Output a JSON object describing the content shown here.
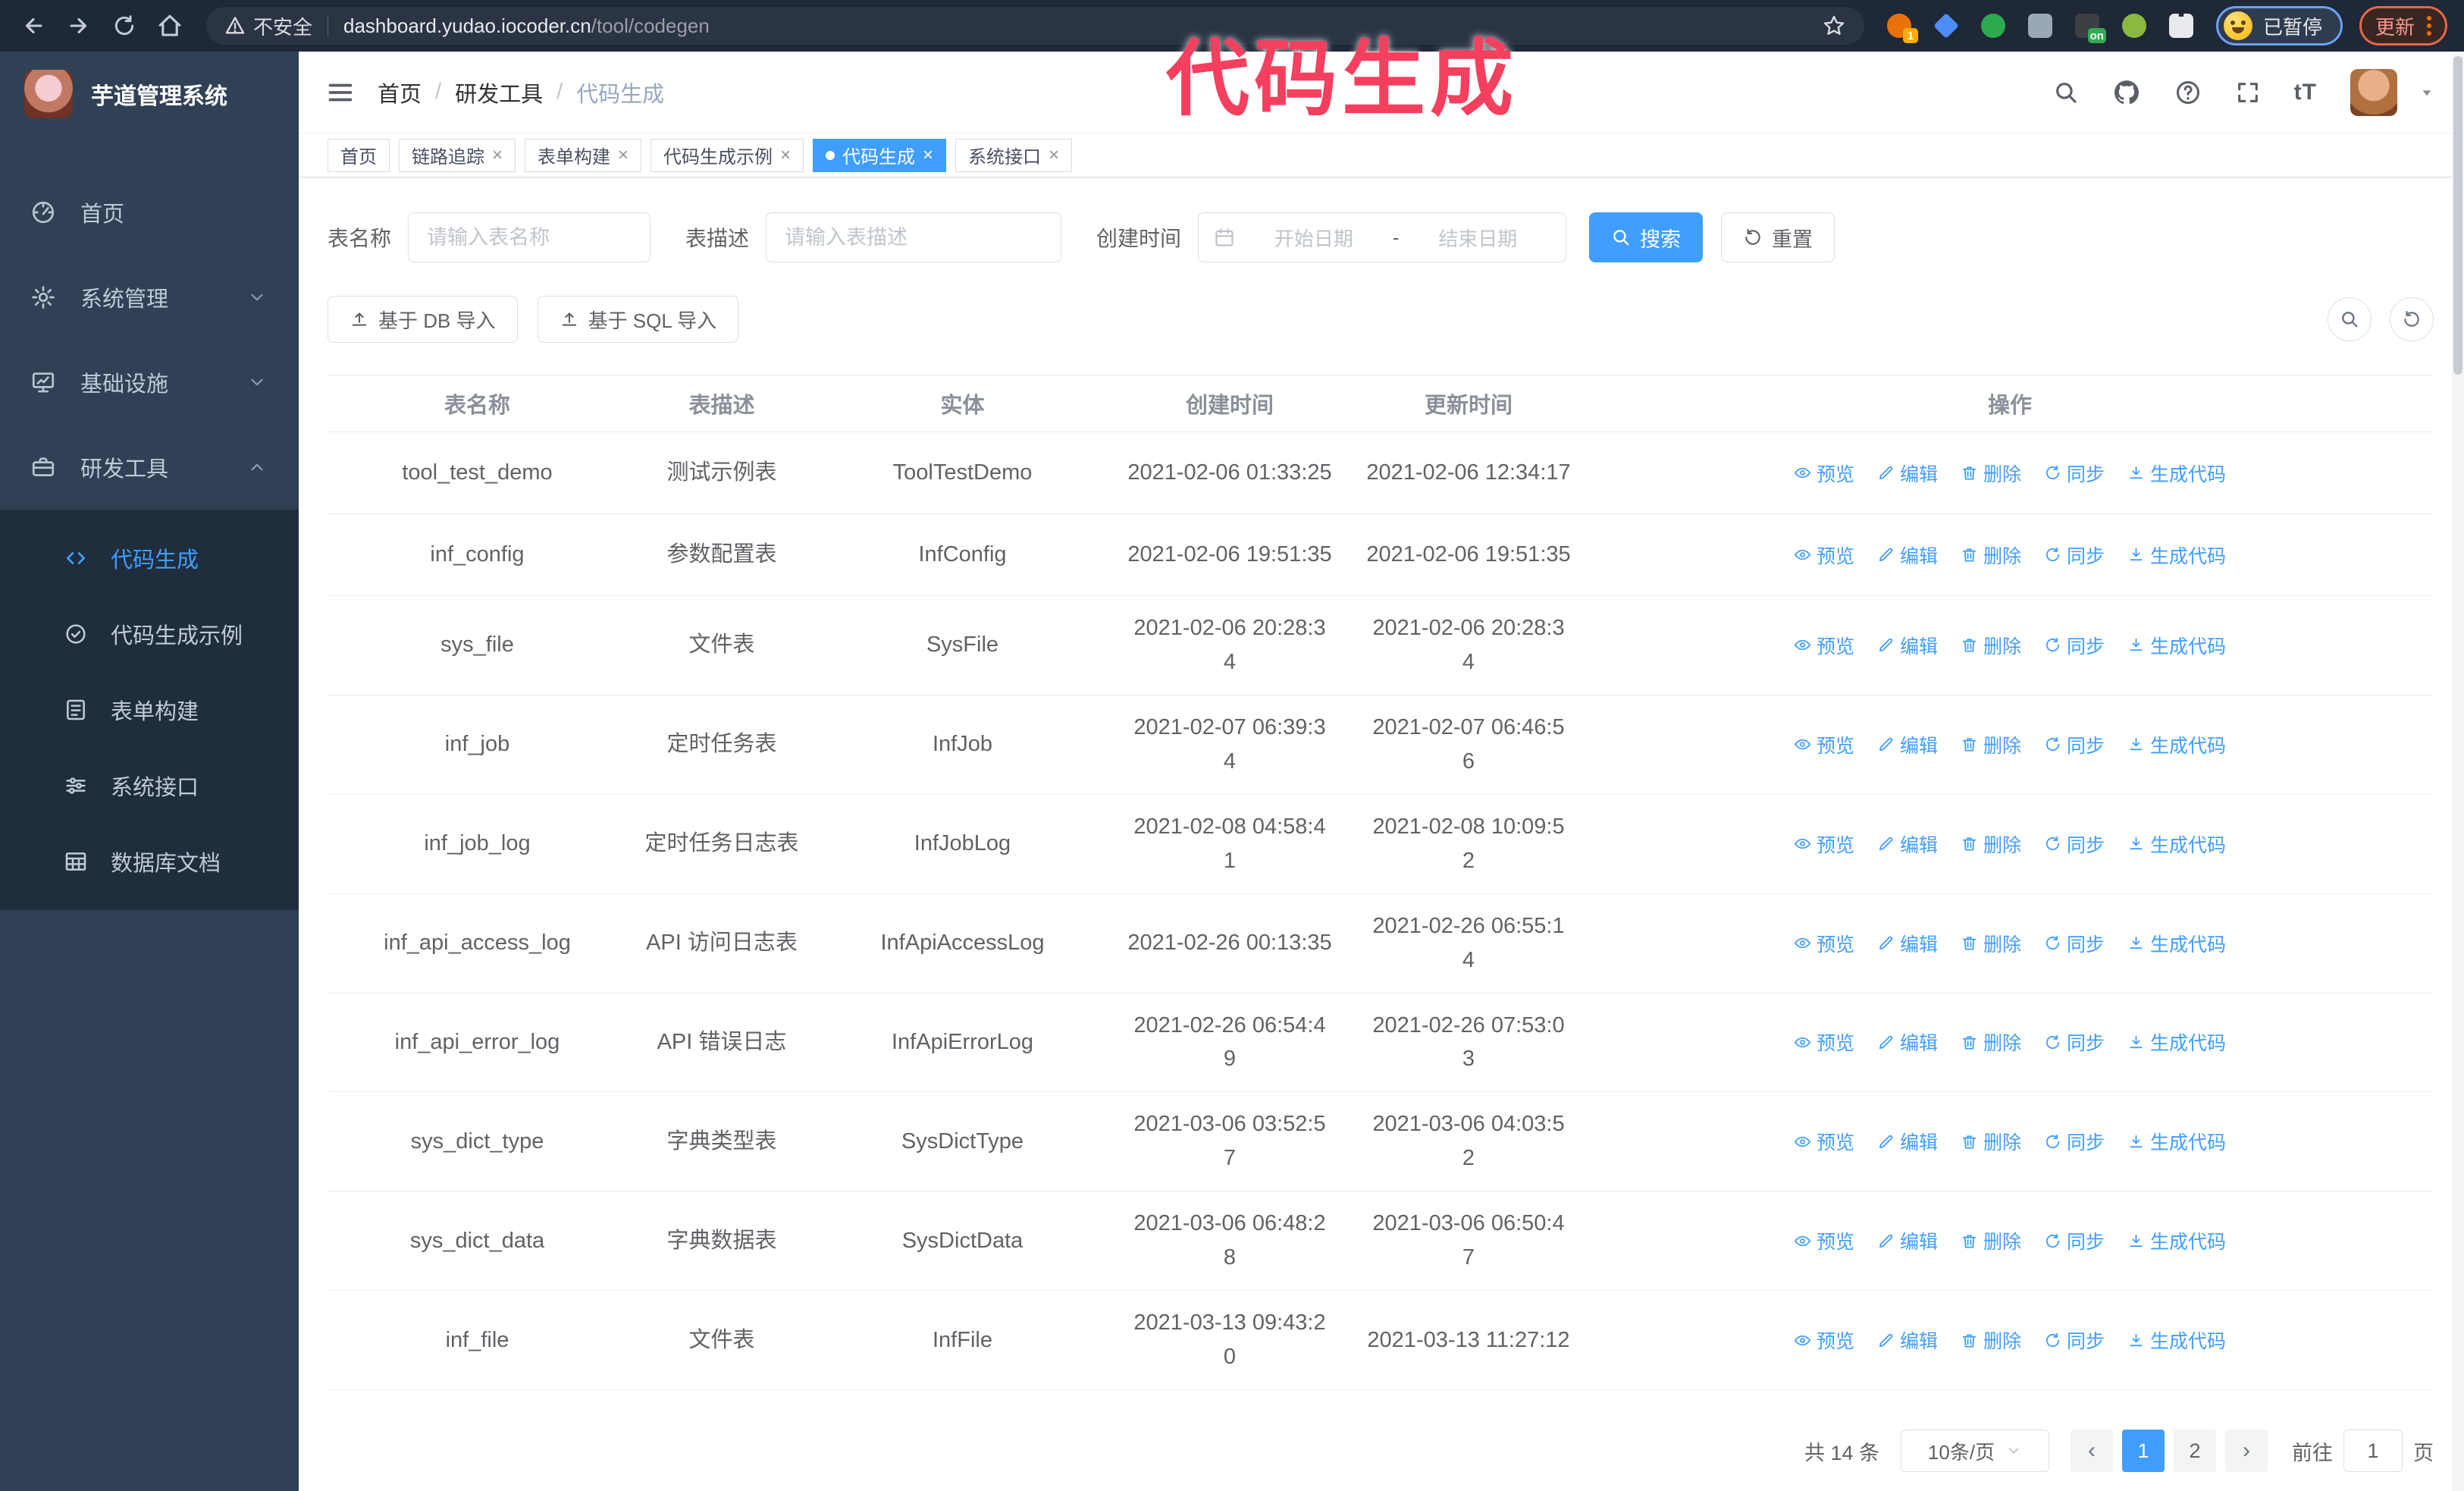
{
  "annotation": {
    "text": "代码生成",
    "color": "#f43f5e"
  },
  "browser": {
    "insecure_label": "不安全",
    "url_domain": "dashboard.yudao.iocoder.cn",
    "url_path": "/tool/codegen",
    "profile_label": "已暂停",
    "update_label": "更新",
    "extensions": [
      {
        "name": "extension-orange",
        "shape": "circle",
        "color": "#e8710a",
        "badge": "1",
        "badge_color": "#f9ab00"
      },
      {
        "name": "extension-blue-gem",
        "shape": "diamond",
        "color": "#4e8cf9"
      },
      {
        "name": "extension-green-check",
        "shape": "circle",
        "color": "#2da94f"
      },
      {
        "name": "extension-grid",
        "shape": "square",
        "color": "#9aa7b5"
      },
      {
        "name": "extension-dark-on",
        "shape": "square",
        "color": "#3c4043",
        "badge": "on",
        "badge_color": "#34a853"
      },
      {
        "name": "extension-green-bot",
        "shape": "circle",
        "color": "#8ab941"
      },
      {
        "name": "extension-puzzle",
        "shape": "puzzle",
        "color": "#e8eaed"
      }
    ]
  },
  "sidebar": {
    "logo_title": "芋道管理系统",
    "items": [
      {
        "id": "home",
        "label": "首页",
        "icon": "i-gauge"
      },
      {
        "id": "system",
        "label": "系统管理",
        "icon": "i-gear",
        "chevron": "down"
      },
      {
        "id": "infra",
        "label": "基础设施",
        "icon": "i-monitor",
        "chevron": "down"
      },
      {
        "id": "devtools",
        "label": "研发工具",
        "icon": "i-toolbox",
        "chevron": "up",
        "active": true
      }
    ],
    "subitems": [
      {
        "id": "codegen",
        "label": "代码生成",
        "icon": "i-code",
        "active": true
      },
      {
        "id": "codegen-demo",
        "label": "代码生成示例",
        "icon": "i-badge"
      },
      {
        "id": "form-builder",
        "label": "表单构建",
        "icon": "i-form"
      },
      {
        "id": "system-api",
        "label": "系统接口",
        "icon": "i-sliders"
      },
      {
        "id": "db-doc",
        "label": "数据库文档",
        "icon": "i-dbgrid"
      }
    ]
  },
  "header": {
    "breadcrumb": [
      "首页",
      "研发工具",
      "代码生成"
    ]
  },
  "tags": [
    {
      "label": "首页",
      "closable": false,
      "active": false
    },
    {
      "label": "链路追踪",
      "closable": true,
      "active": false
    },
    {
      "label": "表单构建",
      "closable": true,
      "active": false
    },
    {
      "label": "代码生成示例",
      "closable": true,
      "active": false
    },
    {
      "label": "代码生成",
      "closable": true,
      "active": true
    },
    {
      "label": "系统接口",
      "closable": true,
      "active": false
    }
  ],
  "filters": {
    "name_label": "表名称",
    "name_placeholder": "请输入表名称",
    "desc_label": "表描述",
    "desc_placeholder": "请输入表描述",
    "time_label": "创建时间",
    "start_placeholder": "开始日期",
    "range_separator": "-",
    "end_placeholder": "结束日期",
    "search_label": "搜索",
    "reset_label": "重置"
  },
  "toolbar": {
    "db_import": "基于 DB 导入",
    "sql_import": "基于 SQL 导入"
  },
  "table": {
    "columns": [
      "表名称",
      "表描述",
      "实体",
      "创建时间",
      "更新时间",
      "操作"
    ],
    "actions": [
      {
        "label": "预览",
        "icon": "eye"
      },
      {
        "label": "编辑",
        "icon": "edit"
      },
      {
        "label": "删除",
        "icon": "trash"
      },
      {
        "label": "同步",
        "icon": "sync"
      },
      {
        "label": "生成代码",
        "icon": "download"
      }
    ],
    "rows": [
      {
        "name": "tool_test_demo",
        "desc": "测试示例表",
        "entity": "ToolTestDemo",
        "created": [
          "2021-02-06 01:33:25"
        ],
        "updated": [
          "2021-02-06 12:34:17"
        ]
      },
      {
        "name": "inf_config",
        "desc": "参数配置表",
        "entity": "InfConfig",
        "created": [
          "2021-02-06 19:51:35"
        ],
        "updated": [
          "2021-02-06 19:51:35"
        ]
      },
      {
        "name": "sys_file",
        "desc": "文件表",
        "entity": "SysFile",
        "created": [
          "2021-02-06 20:28:3",
          "4"
        ],
        "updated": [
          "2021-02-06 20:28:3",
          "4"
        ]
      },
      {
        "name": "inf_job",
        "desc": "定时任务表",
        "entity": "InfJob",
        "created": [
          "2021-02-07 06:39:3",
          "4"
        ],
        "updated": [
          "2021-02-07 06:46:5",
          "6"
        ]
      },
      {
        "name": "inf_job_log",
        "desc": "定时任务日志表",
        "entity": "InfJobLog",
        "created": [
          "2021-02-08 04:58:4",
          "1"
        ],
        "updated": [
          "2021-02-08 10:09:5",
          "2"
        ]
      },
      {
        "name": "inf_api_access_log",
        "desc": "API 访问日志表",
        "entity": "InfApiAccessLog",
        "created": [
          "2021-02-26 00:13:35"
        ],
        "updated": [
          "2021-02-26 06:55:1",
          "4"
        ]
      },
      {
        "name": "inf_api_error_log",
        "desc": "API 错误日志",
        "entity": "InfApiErrorLog",
        "created": [
          "2021-02-26 06:54:4",
          "9"
        ],
        "updated": [
          "2021-02-26 07:53:0",
          "3"
        ]
      },
      {
        "name": "sys_dict_type",
        "desc": "字典类型表",
        "entity": "SysDictType",
        "created": [
          "2021-03-06 03:52:5",
          "7"
        ],
        "updated": [
          "2021-03-06 04:03:5",
          "2"
        ]
      },
      {
        "name": "sys_dict_data",
        "desc": "字典数据表",
        "entity": "SysDictData",
        "created": [
          "2021-03-06 06:48:2",
          "8"
        ],
        "updated": [
          "2021-03-06 06:50:4",
          "7"
        ]
      },
      {
        "name": "inf_file",
        "desc": "文件表",
        "entity": "InfFile",
        "created": [
          "2021-03-13 09:43:2",
          "0"
        ],
        "updated": [
          "2021-03-13 11:27:12"
        ]
      }
    ]
  },
  "pagination": {
    "total": "共 14 条",
    "page_size": "10条/页",
    "prev": "‹",
    "next": "›",
    "pages": [
      "1",
      "2"
    ],
    "active_page": "1",
    "goto_label": "前往",
    "goto_value": "1",
    "page_suffix": "页"
  },
  "colors": {
    "accent": "#409eff",
    "sidebar": "#304156",
    "submenu": "#1f2d3d",
    "annotation": "#f43f5e"
  }
}
